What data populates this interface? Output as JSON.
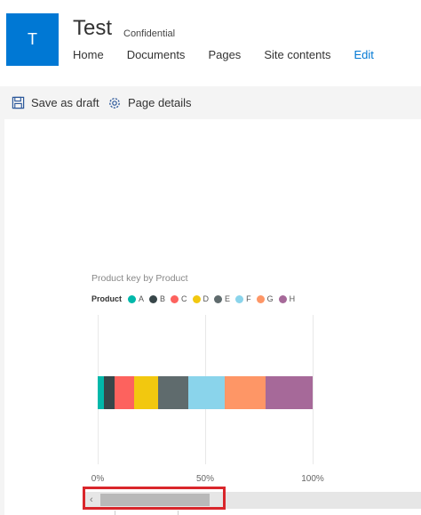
{
  "site": {
    "logo_letter": "T",
    "title": "Test",
    "classification": "Confidential"
  },
  "nav": {
    "items": [
      {
        "label": "Home"
      },
      {
        "label": "Documents"
      },
      {
        "label": "Pages"
      },
      {
        "label": "Site contents"
      },
      {
        "label": "Edit"
      }
    ]
  },
  "commandbar": {
    "save_label": "Save as draft",
    "details_label": "Page details",
    "save_icon": "save-icon",
    "details_icon": "gear-icon"
  },
  "chart_data": {
    "type": "bar",
    "orientation": "horizontal-stacked-100",
    "title": "Product key by Product",
    "legend_title": "Product",
    "legend_position": "top-left",
    "grid": true,
    "xlim": [
      0,
      100
    ],
    "x_ticks": [
      "0%",
      "50%",
      "100%"
    ],
    "series": [
      {
        "name": "A",
        "value": 3,
        "color": "#01b8aa"
      },
      {
        "name": "B",
        "value": 5,
        "color": "#374649"
      },
      {
        "name": "C",
        "value": 9,
        "color": "#fd625e"
      },
      {
        "name": "D",
        "value": 11,
        "color": "#f2c80f"
      },
      {
        "name": "E",
        "value": 14,
        "color": "#5f6b6d"
      },
      {
        "name": "F",
        "value": 17,
        "color": "#8ad4eb"
      },
      {
        "name": "G",
        "value": 19,
        "color": "#fe9666"
      },
      {
        "name": "H",
        "value": 22,
        "color": "#a66999"
      }
    ]
  },
  "scrollbar": {
    "left_arrow": "‹"
  }
}
